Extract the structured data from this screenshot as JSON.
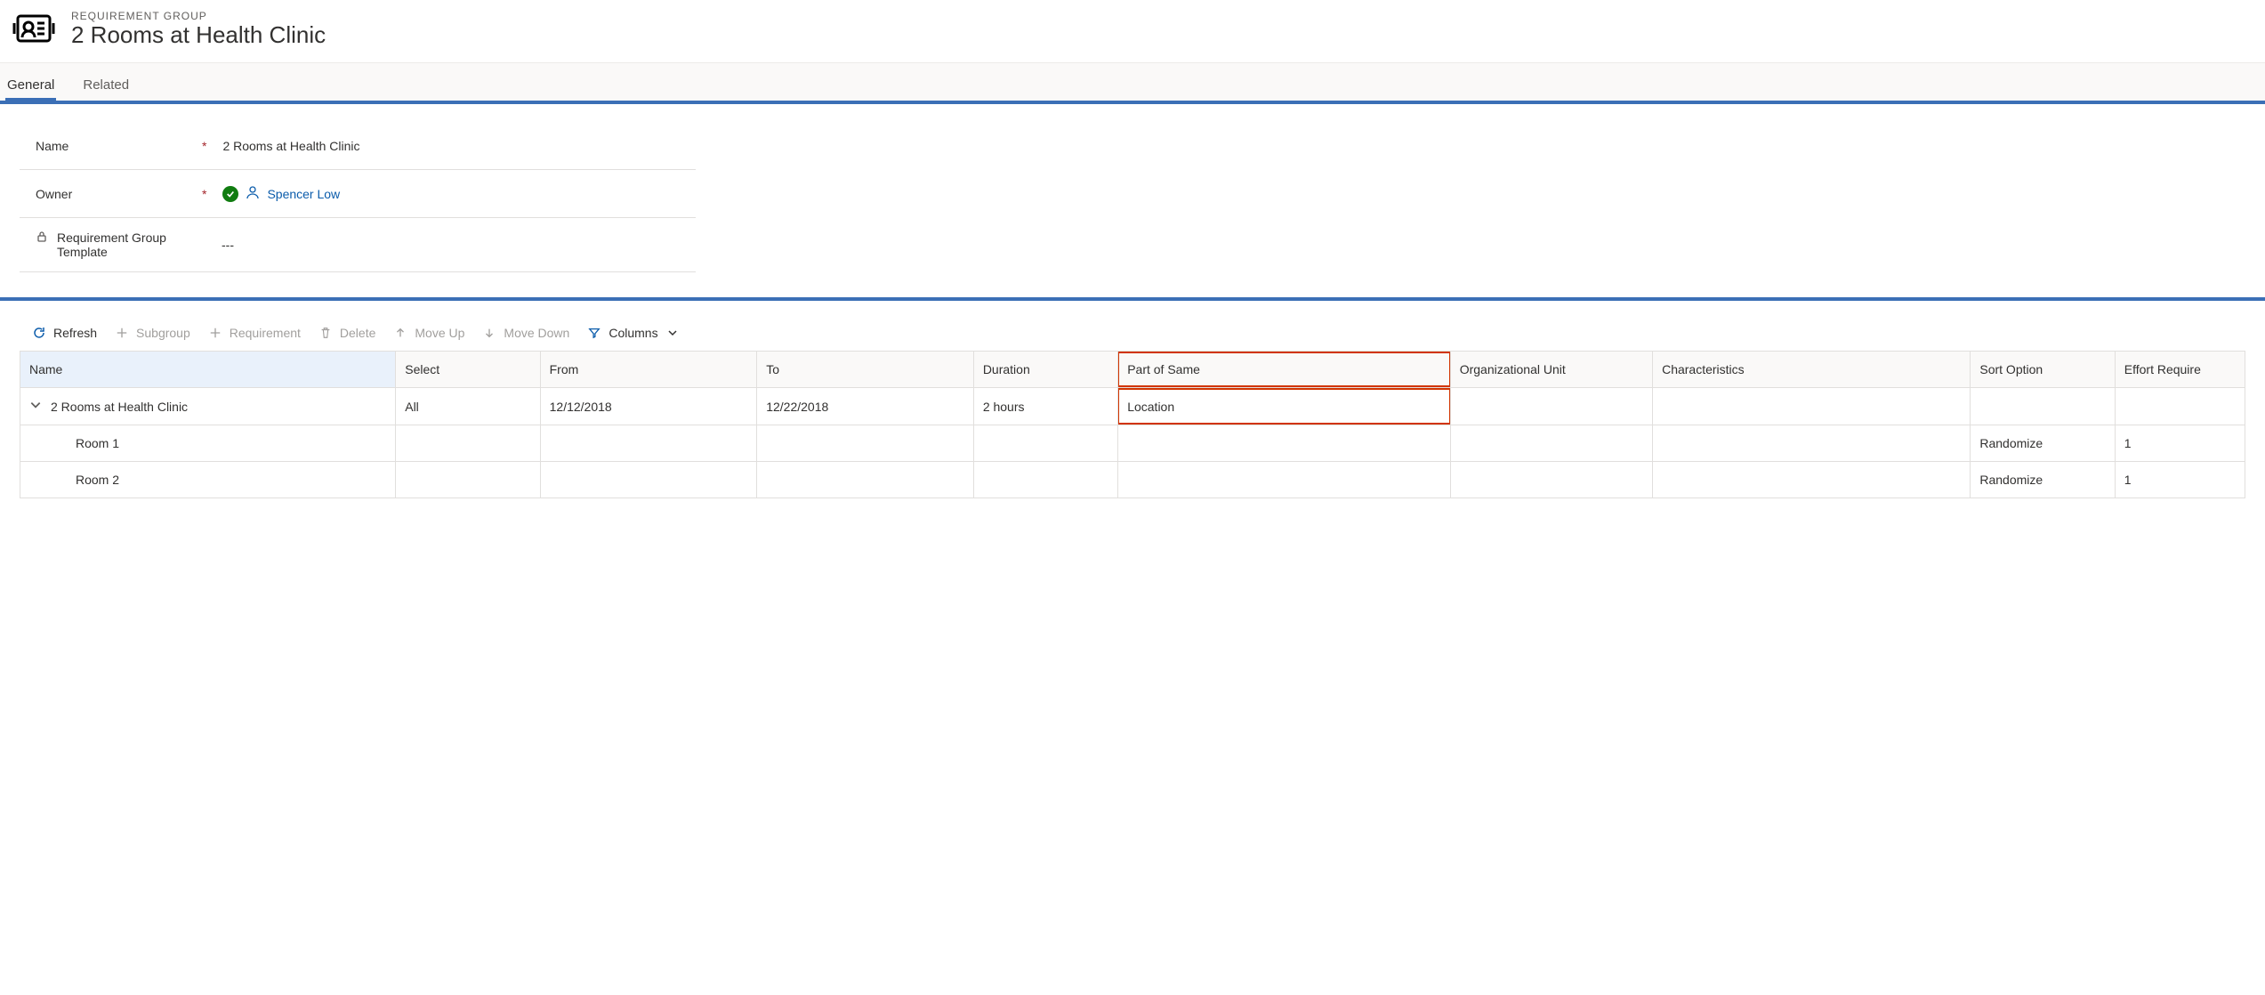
{
  "header": {
    "eyebrow": "REQUIREMENT GROUP",
    "title": "2 Rooms at Health Clinic"
  },
  "tabs": {
    "general": "General",
    "related": "Related"
  },
  "form": {
    "name_label": "Name",
    "name_value": "2 Rooms at Health Clinic",
    "owner_label": "Owner",
    "owner_value": "Spencer Low",
    "template_label": "Requirement Group Template",
    "template_value": "---"
  },
  "toolbar": {
    "refresh": "Refresh",
    "subgroup": "Subgroup",
    "requirement": "Requirement",
    "delete": "Delete",
    "move_up": "Move Up",
    "move_down": "Move Down",
    "columns": "Columns"
  },
  "grid": {
    "headers": {
      "name": "Name",
      "select": "Select",
      "from": "From",
      "to": "To",
      "duration": "Duration",
      "part_of_same": "Part of Same",
      "org_unit": "Organizational Unit",
      "characteristics": "Characteristics",
      "sort_option": "Sort Option",
      "effort_required": "Effort Require"
    },
    "rows": [
      {
        "name": "2 Rooms at Health Clinic",
        "select": "All",
        "from": "12/12/2018",
        "to": "12/22/2018",
        "duration": "2 hours",
        "part_of_same": "Location",
        "org_unit": "",
        "characteristics": "",
        "sort_option": "",
        "effort_required": "",
        "is_parent": true
      },
      {
        "name": "Room 1",
        "select": "",
        "from": "",
        "to": "",
        "duration": "",
        "part_of_same": "",
        "org_unit": "",
        "characteristics": "",
        "sort_option": "Randomize",
        "effort_required": "1",
        "is_parent": false
      },
      {
        "name": "Room 2",
        "select": "",
        "from": "",
        "to": "",
        "duration": "",
        "part_of_same": "",
        "org_unit": "",
        "characteristics": "",
        "sort_option": "Randomize",
        "effort_required": "1",
        "is_parent": false
      }
    ]
  }
}
